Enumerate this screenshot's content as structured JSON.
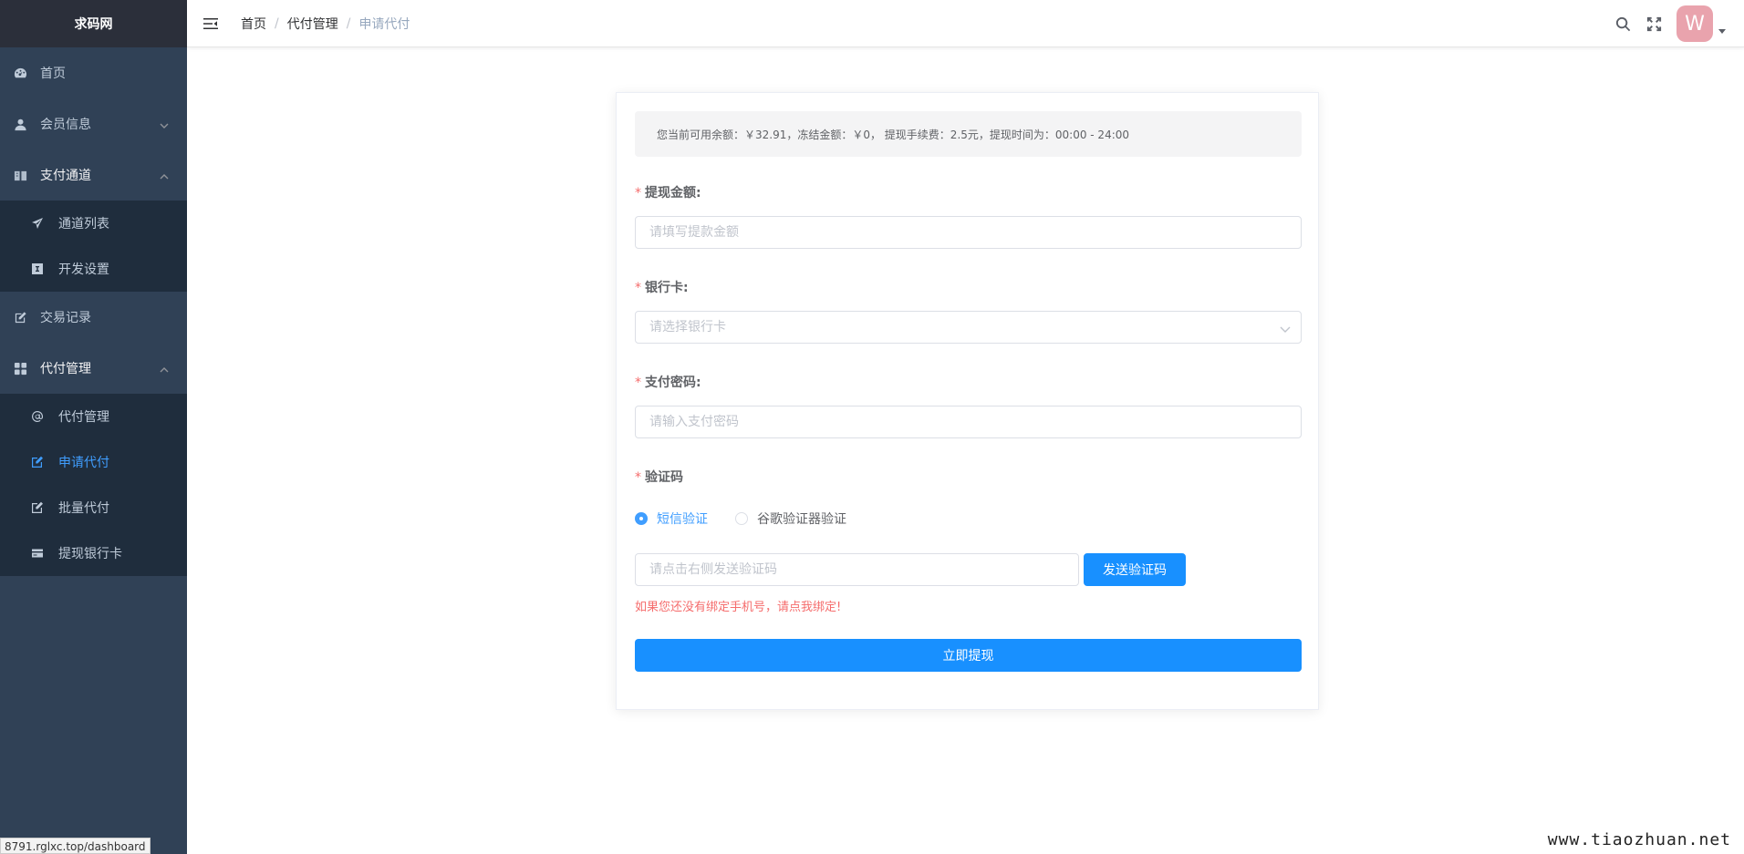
{
  "app": {
    "logo": "求码网"
  },
  "sidebar": {
    "items": [
      {
        "label": "首页",
        "icon": "dashboard-icon"
      },
      {
        "label": "会员信息",
        "icon": "user-icon"
      },
      {
        "label": "支付通道",
        "icon": "book-icon"
      },
      {
        "label": "交易记录",
        "icon": "edit-icon"
      },
      {
        "label": "代付管理",
        "icon": "grid-icon"
      }
    ],
    "pay_channel_sub": [
      {
        "label": "通道列表",
        "icon": "send-icon"
      },
      {
        "label": "开发设置",
        "icon": "dev-icon"
      }
    ],
    "payout_sub": [
      {
        "label": "代付管理",
        "icon": "at-icon"
      },
      {
        "label": "申请代付",
        "icon": "edit-icon"
      },
      {
        "label": "批量代付",
        "icon": "edit-icon"
      },
      {
        "label": "提现银行卡",
        "icon": "card-icon"
      }
    ]
  },
  "status_url": "8791.rglxc.top/dashboard",
  "header": {
    "breadcrumb": [
      "首页",
      "代付管理",
      "申请代付"
    ],
    "avatar_letter": "W"
  },
  "form": {
    "notice": "您当前可用余额：￥32.91，冻结金额：￥0， 提现手续费：2.5元，提现时间为：00:00 - 24:00",
    "amount_label": "提现金额:",
    "amount_placeholder": "请填写提款金额",
    "bank_label": "银行卡:",
    "bank_placeholder": "请选择银行卡",
    "password_label": "支付密码:",
    "password_placeholder": "请输入支付密码",
    "code_label": "验证码",
    "radio_sms": "短信验证",
    "radio_google": "谷歌验证器验证",
    "code_placeholder": "请点击右侧发送验证码",
    "send_button": "发送验证码",
    "bind_hint": "如果您还没有绑定手机号，请点我绑定!",
    "submit_button": "立即提现"
  },
  "watermark": "www.tiaozhuan.net",
  "colors": {
    "sidebar_bg": "#304156",
    "submenu_bg": "#1f2d3d",
    "primary": "#1890ff",
    "active": "#409eff",
    "danger": "#f56c6c"
  }
}
